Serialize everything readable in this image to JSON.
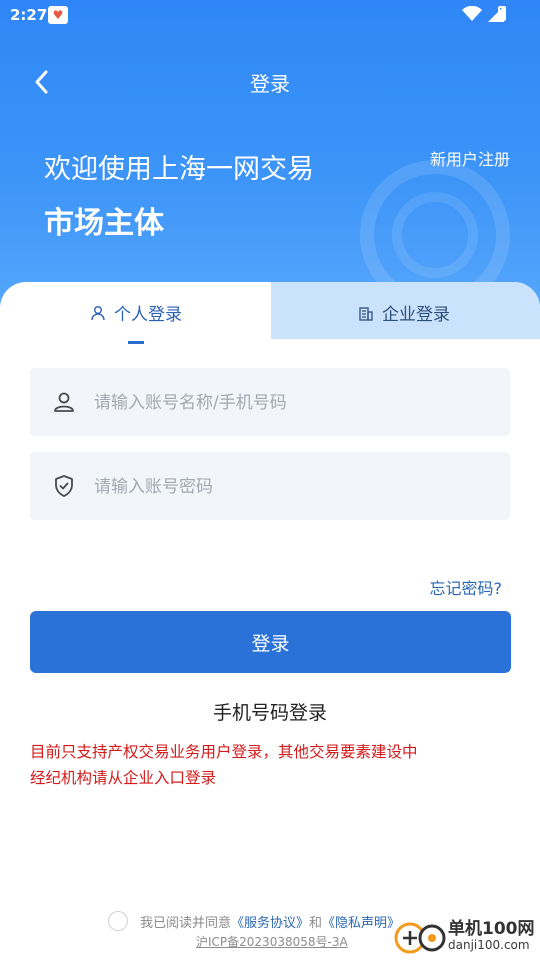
{
  "status_bar": {
    "time": "2:27"
  },
  "nav": {
    "title": "登录"
  },
  "hero": {
    "welcome": "欢迎使用上海一网交易",
    "subtitle": "市场主体",
    "register_link": "新用户注册"
  },
  "tabs": [
    {
      "label": "个人登录",
      "icon": "user-icon",
      "active": true
    },
    {
      "label": "企业登录",
      "icon": "building-icon",
      "active": false
    }
  ],
  "form": {
    "account_placeholder": "请输入账号名称/手机号码",
    "password_placeholder": "请输入账号密码",
    "forgot_password": "忘记密码?",
    "login_button": "登录",
    "phone_login": "手机号码登录"
  },
  "notice": {
    "line1": "目前只支持产权交易业务用户登录，其他交易要素建设中",
    "line2": "经纪机构请从企业入口登录"
  },
  "agreement": {
    "prefix": "我已阅读并同意",
    "service": "《服务协议》",
    "and": "和",
    "privacy": "《隐私声明》",
    "icp": "沪ICP备2023038058号-3A"
  },
  "watermark": {
    "cn": "单机100网",
    "url": "danji100.com"
  },
  "colors": {
    "primary": "#2b72d8",
    "header": "#3d95f8",
    "notice": "#d51a1a",
    "link": "#2b68b3"
  }
}
